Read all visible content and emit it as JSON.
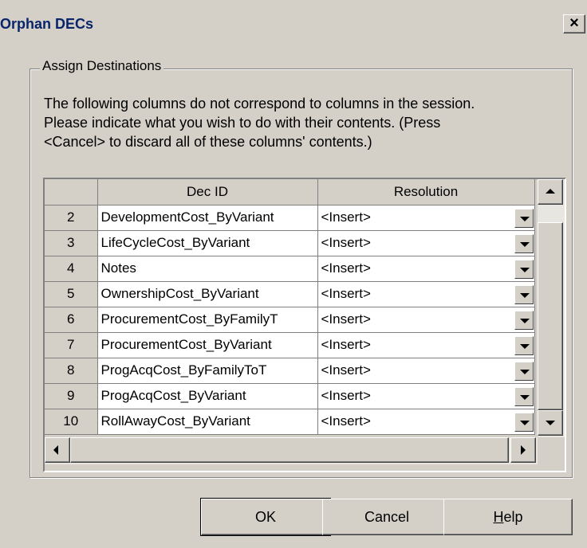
{
  "window": {
    "title": "Orphan DECs",
    "close_glyph": "×"
  },
  "group": {
    "label": "Assign Destinations",
    "description_lines": [
      "The following columns do not correspond to columns in the session.",
      "Please indicate what you wish to do with their contents. (Press",
      "<Cancel> to discard all of these columns' contents.)"
    ]
  },
  "grid": {
    "columns": [
      "",
      "Dec ID",
      "Resolution"
    ],
    "rows": [
      {
        "num": "2",
        "dec_id": "DevelopmentCost_ByVariant",
        "resolution": "<Insert>"
      },
      {
        "num": "3",
        "dec_id": "LifeCycleCost_ByVariant",
        "resolution": "<Insert>"
      },
      {
        "num": "4",
        "dec_id": "Notes",
        "resolution": "<Insert>"
      },
      {
        "num": "5",
        "dec_id": "OwnershipCost_ByVariant",
        "resolution": "<Insert>"
      },
      {
        "num": "6",
        "dec_id": "ProcurementCost_ByFamilyT",
        "resolution": "<Insert>"
      },
      {
        "num": "7",
        "dec_id": "ProcurementCost_ByVariant",
        "resolution": "<Insert>"
      },
      {
        "num": "8",
        "dec_id": "ProgAcqCost_ByFamilyToT",
        "resolution": "<Insert>"
      },
      {
        "num": "9",
        "dec_id": "ProgAcqCost_ByVariant",
        "resolution": "<Insert>"
      },
      {
        "num": "10",
        "dec_id": "RollAwayCost_ByVariant",
        "resolution": "<Insert>"
      }
    ]
  },
  "buttons": {
    "ok": "OK",
    "cancel": "Cancel",
    "help_mnemonic": "H",
    "help_rest": "elp"
  },
  "colors": {
    "dialog_bg": "#d4d0c8",
    "title_text": "#0a246a"
  }
}
